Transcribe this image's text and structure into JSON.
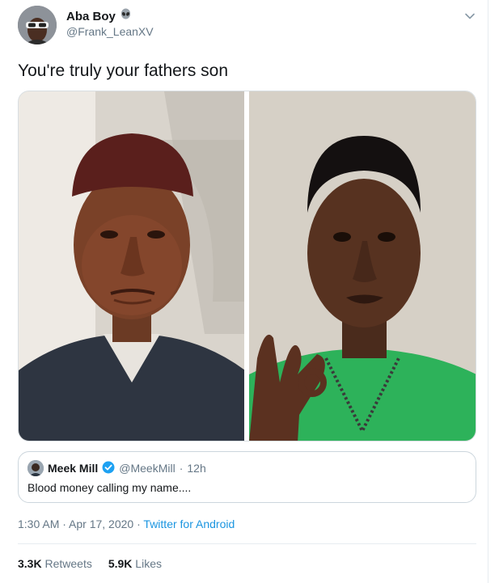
{
  "author": {
    "name": "Aba Boy",
    "name_emoji": "alien-emoji",
    "handle": "@Frank_LeanXV"
  },
  "tweet": {
    "text": "You're truly your fathers son",
    "timestamp": "1:30 AM · Apr 17, 2020",
    "separator": "·",
    "source": "Twitter for Android"
  },
  "quoted": {
    "name": "Meek Mill",
    "verified_icon": "verified-badge-icon",
    "handle": "@MeekMill",
    "dot": "·",
    "age": "12h",
    "text": "Blood money calling my name...."
  },
  "stats": {
    "retweets_count": "3.3K",
    "retweets_label": "Retweets",
    "likes_count": "5.9K",
    "likes_label": "Likes"
  },
  "colors": {
    "link": "#1b95e0",
    "verified": "#1da1f2",
    "secondary_text": "#657786",
    "border": "#e6ecf0"
  }
}
